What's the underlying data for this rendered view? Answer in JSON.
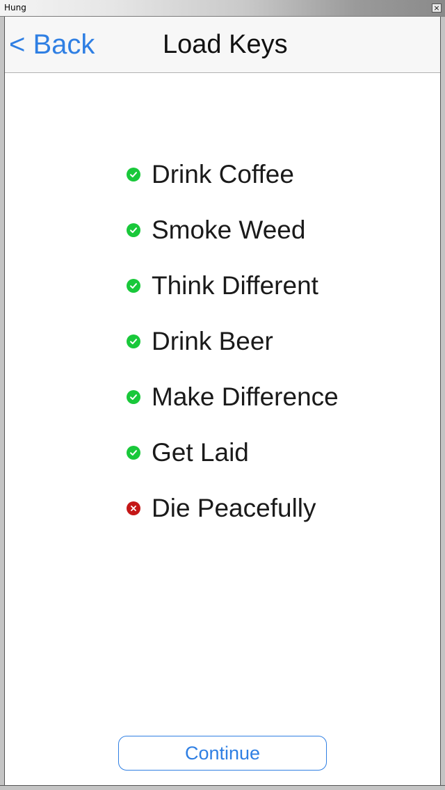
{
  "window": {
    "title": "Hung",
    "close_glyph": "×"
  },
  "navbar": {
    "back_label": "< Back",
    "title": "Load Keys"
  },
  "checklist": {
    "items": [
      {
        "label": "Drink Coffee",
        "status": "done",
        "icon": "check-icon"
      },
      {
        "label": "Smoke Weed",
        "status": "done",
        "icon": "check-icon"
      },
      {
        "label": "Think Different",
        "status": "done",
        "icon": "check-icon"
      },
      {
        "label": "Drink Beer",
        "status": "done",
        "icon": "check-icon"
      },
      {
        "label": "Make Difference",
        "status": "done",
        "icon": "check-icon"
      },
      {
        "label": "Get Laid",
        "status": "done",
        "icon": "check-icon"
      },
      {
        "label": "Die Peacefully",
        "status": "failed",
        "icon": "x-icon"
      }
    ]
  },
  "footer": {
    "continue_label": "Continue"
  },
  "colors": {
    "accent": "#2f7fe3",
    "done": "#19c83a",
    "failed": "#c41717"
  }
}
